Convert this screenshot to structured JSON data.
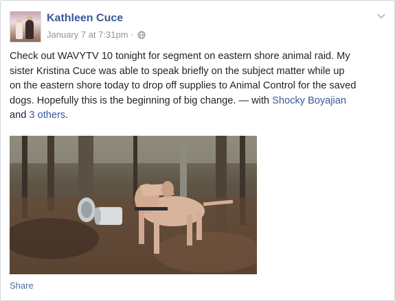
{
  "post": {
    "author": "Kathleen Cuce",
    "timestamp": "January 7 at 7:31pm",
    "separator": "·",
    "privacy_icon": "globe-icon",
    "menu_icon": "chevron-down-icon",
    "text_lines": [
      "Check out WAVYTV 10 tonight for segment on eastern shore animal raid. My",
      "sister Kristina Cuce was able to speak briefly on the subject matter while up",
      "on the eastern shore today to drop off supplies to Animal Control for the saved",
      "dogs. Hopefully this is the beginning of big change. — with "
    ],
    "tagged_person": "Shocky Boyajian",
    "and_text": "and ",
    "others_link": "3 others",
    "period": ".",
    "photo_alt": "",
    "share_label": "Share"
  },
  "colors": {
    "link": "#3b5998",
    "meta": "#90949c",
    "text": "#1d2129",
    "border": "#cfd2d8"
  }
}
